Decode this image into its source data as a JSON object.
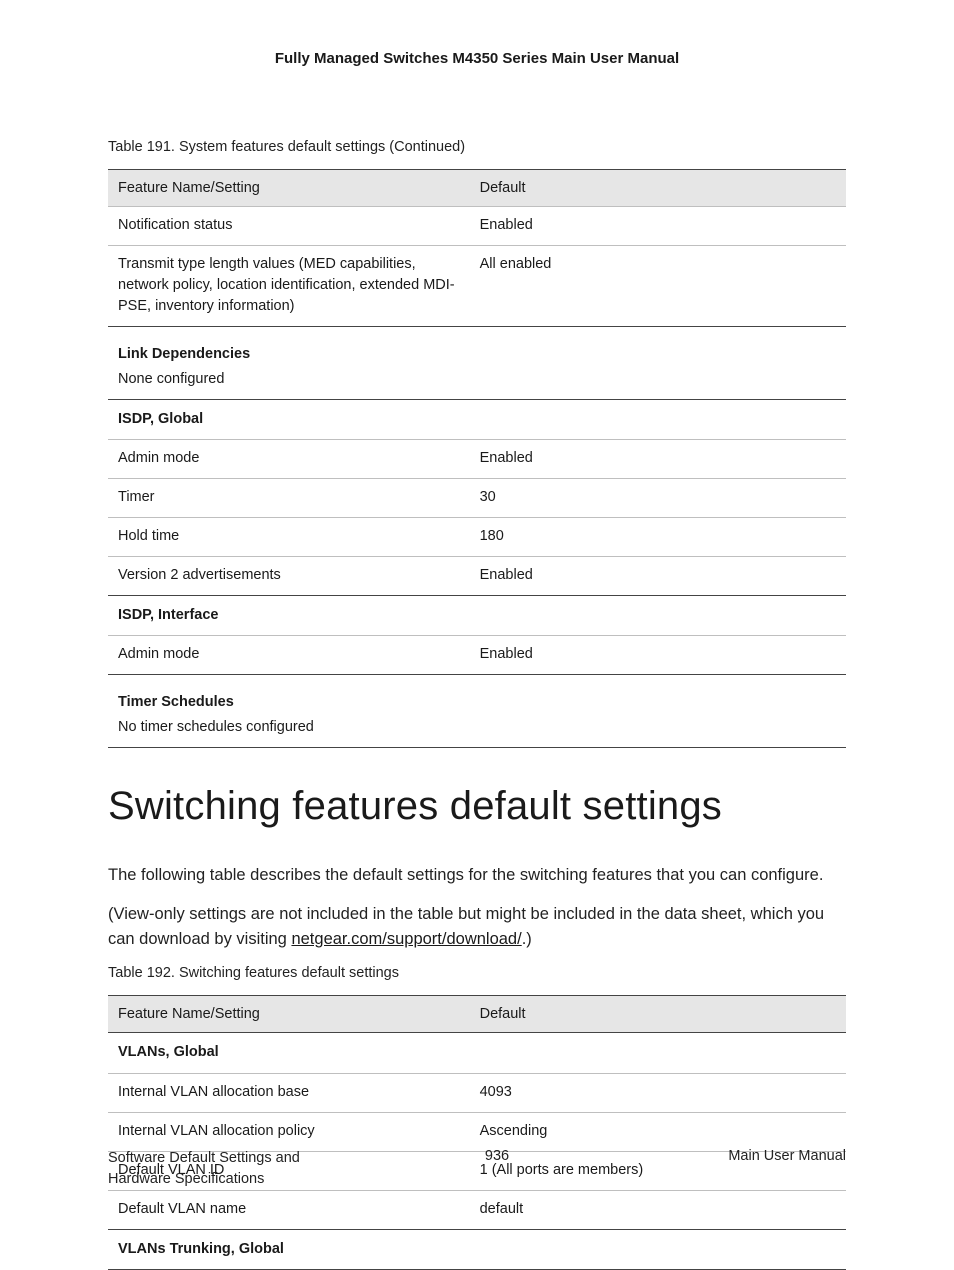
{
  "header": {
    "doc_title": "Fully Managed Switches M4350 Series Main User Manual"
  },
  "table191": {
    "caption": "Table 191. System features default settings (Continued)",
    "columns": [
      "Feature Name/Setting",
      "Default"
    ],
    "rows": [
      {
        "type": "data",
        "name": "Notification status",
        "default": "Enabled"
      },
      {
        "type": "data",
        "name": "Transmit type length values (MED capabilities, network policy, location identification, extended MDI-PSE, inventory information)",
        "default": "All enabled"
      },
      {
        "type": "section",
        "title": "Link Dependencies",
        "subtitle": "None configured"
      },
      {
        "type": "section",
        "title": "ISDP, Global"
      },
      {
        "type": "data",
        "name": "Admin mode",
        "default": "Enabled"
      },
      {
        "type": "data",
        "name": "Timer",
        "default": "30"
      },
      {
        "type": "data",
        "name": "Hold time",
        "default": "180"
      },
      {
        "type": "data",
        "name": "Version 2 advertisements",
        "default": "Enabled"
      },
      {
        "type": "section",
        "title": "ISDP, Interface"
      },
      {
        "type": "data",
        "name": "Admin mode",
        "default": "Enabled"
      },
      {
        "type": "section",
        "title": "Timer Schedules",
        "subtitle": "No timer schedules configured"
      }
    ]
  },
  "section": {
    "heading": "Switching features default settings",
    "para1": "The following table describes the default settings for the switching features that you can configure.",
    "para2_prefix": "(View-only settings are not included in the table but might be included in the data sheet, which you can download by visiting ",
    "para2_link": "netgear.com/support/download/",
    "para2_suffix": ".)"
  },
  "table192": {
    "caption": "Table 192. Switching features default settings",
    "columns": [
      "Feature Name/Setting",
      "Default"
    ],
    "rows": [
      {
        "type": "section",
        "title": "VLANs, Global"
      },
      {
        "type": "data",
        "name": "Internal VLAN allocation base",
        "default": "4093"
      },
      {
        "type": "data",
        "name": "Internal VLAN allocation policy",
        "default": "Ascending"
      },
      {
        "type": "data",
        "name": "Default VLAN ID",
        "default": "1 (All ports are members)"
      },
      {
        "type": "data",
        "name": "Default VLAN name",
        "default": "default"
      },
      {
        "type": "section",
        "title": "VLANs Trunking, Global"
      }
    ]
  },
  "footer": {
    "left": "Software Default Settings and Hardware Specifications",
    "center": "936",
    "right": "Main User Manual"
  }
}
